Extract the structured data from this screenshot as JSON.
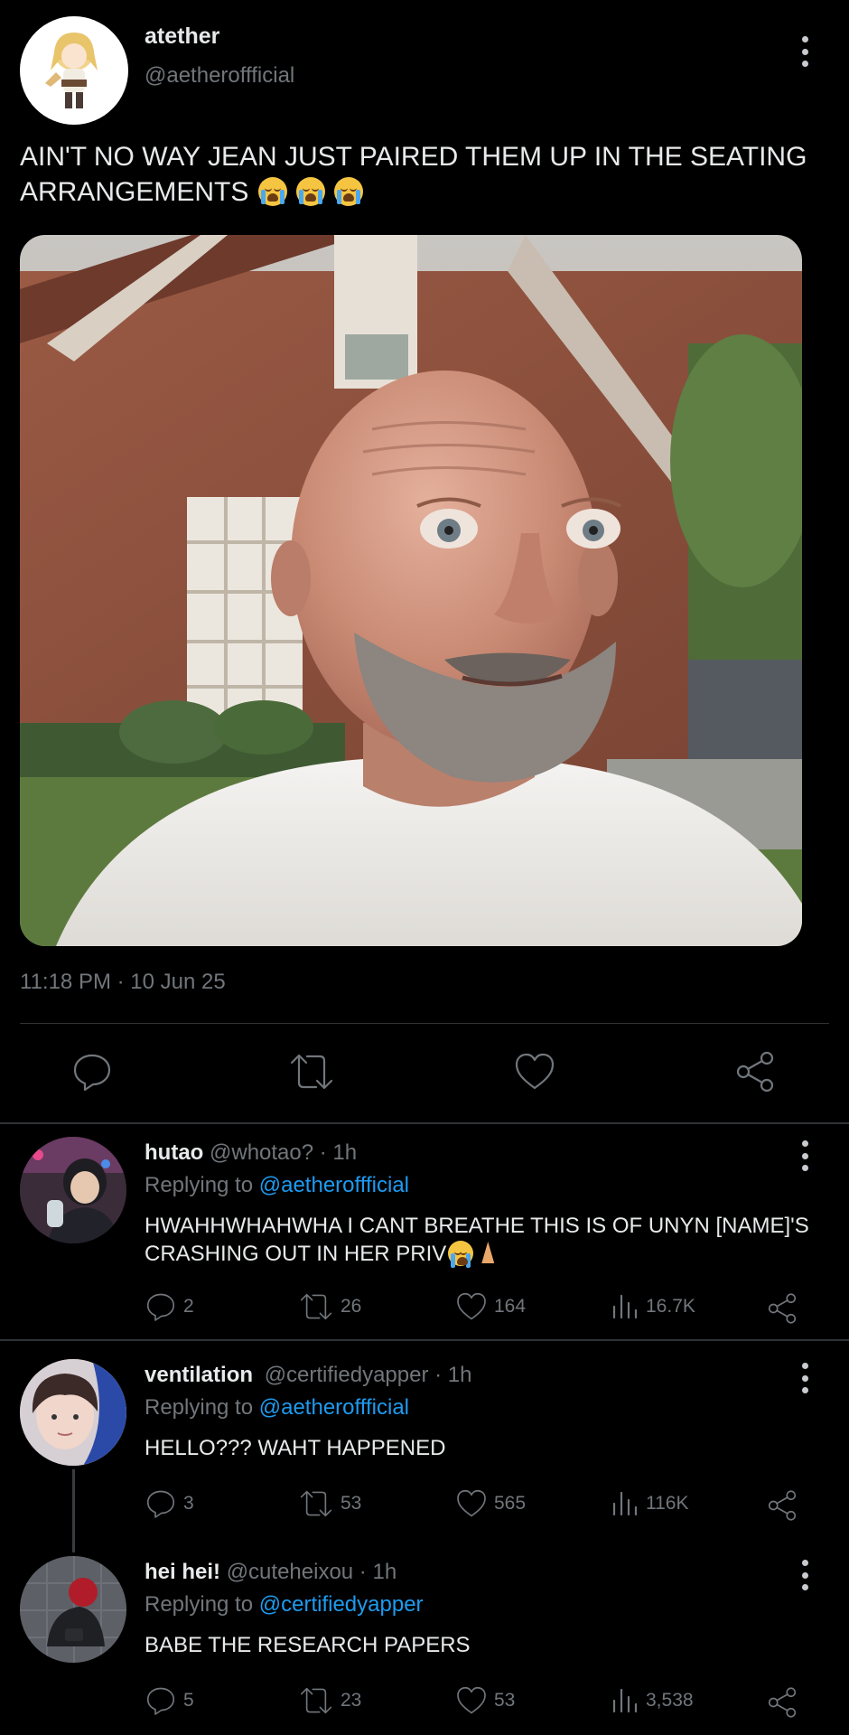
{
  "tweet": {
    "author_name": "atether",
    "author_handle": "@aetheroffficial",
    "text_line1": "AIN'T NO WAY JEAN JUST PAIRED THEM UP IN THE SEATING",
    "text_line2": "ARRANGEMENTS",
    "emojis": [
      "loudly-crying-face",
      "loudly-crying-face",
      "loudly-crying-face"
    ],
    "timestamp": "11:18 PM · 10 Jun 25",
    "actions": [
      "reply-icon",
      "retweet-icon",
      "like-icon",
      "share-icon"
    ]
  },
  "replies": [
    {
      "name": "hutao",
      "handle_time": "@whotao? · 1h",
      "replying_prefix": "Replying to",
      "replying_to": "@aetheroffficial",
      "text_line1": "HWAHHWHAHWHA I CANT BREATHE THIS IS OF UNYN [NAME]'S",
      "text_line2": "CRASHING OUT IN HER PRIV",
      "emojis": [
        "loudly-crying-face",
        "folded-hands"
      ],
      "replies": "2",
      "retweets": "26",
      "likes": "164",
      "views": "16.7K"
    },
    {
      "name": "ventilation",
      "handle_time": "@certifiedyapper · 1h",
      "replying_prefix": "Replying to",
      "replying_to": "@aetheroffficial",
      "text_line1": "HELLO??? WAHT HAPPENED",
      "replies": "3",
      "retweets": "53",
      "likes": "565",
      "views": "116K"
    },
    {
      "name": "hei hei!",
      "handle_time": "@cuteheixou · 1h",
      "replying_prefix": "Replying to",
      "replying_to": "@certifiedyapper",
      "text_line1": "BABE THE RESEARCH PAPERS",
      "replies": "5",
      "retweets": "23",
      "likes": "53",
      "views": "3,538"
    }
  ],
  "colors": {
    "background": "#000000",
    "text": "#e7e9ea",
    "muted": "#71767b",
    "link": "#1d9bf0"
  }
}
